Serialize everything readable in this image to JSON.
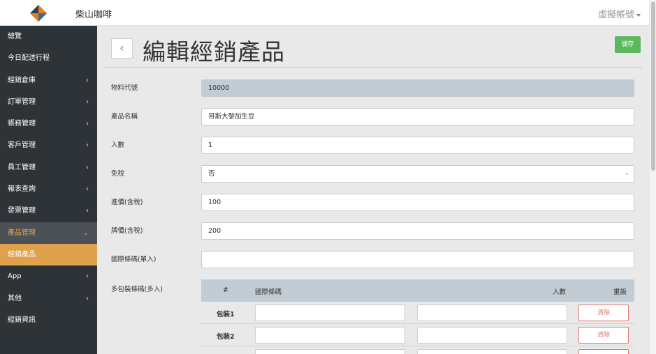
{
  "topbar": {
    "brand": "柴山咖啡",
    "user": "虛擬帳號"
  },
  "colors": {
    "sidebar_bg": "#2e3338",
    "active_item": "#e0a14c",
    "save_green": "#5cb85c",
    "clear_red": "#e4776f",
    "readonly_bg": "#c2ccd4"
  },
  "sidebar": {
    "items": [
      {
        "label": "總覽",
        "arrow": ""
      },
      {
        "label": "今日配送行程",
        "arrow": ""
      },
      {
        "label": "經銷倉庫",
        "arrow": "‹"
      },
      {
        "label": "訂單管理",
        "arrow": "‹"
      },
      {
        "label": "帳務管理",
        "arrow": "‹"
      },
      {
        "label": "客戶管理",
        "arrow": "‹"
      },
      {
        "label": "員工管理",
        "arrow": "‹"
      },
      {
        "label": "報表查詢",
        "arrow": "‹"
      },
      {
        "label": "發票管理",
        "arrow": "‹"
      },
      {
        "label": "產品管理",
        "arrow": "⌄"
      },
      {
        "label": "經銷產品",
        "arrow": ""
      },
      {
        "label": "App",
        "arrow": "‹"
      },
      {
        "label": "其他",
        "arrow": "‹"
      },
      {
        "label": "經銷資訊",
        "arrow": ""
      }
    ]
  },
  "page": {
    "title": "編輯經銷產品",
    "back": "‹",
    "save": "儲存"
  },
  "form": {
    "material_code": {
      "label": "物料代號",
      "value": "10000"
    },
    "product_name": {
      "label": "產品名稱",
      "value": "哥斯大黎加生豆"
    },
    "quantity": {
      "label": "入數",
      "value": "1"
    },
    "tax_free": {
      "label": "免稅",
      "value": "否"
    },
    "purchase_price": {
      "label": "進價(含稅)",
      "value": "100"
    },
    "list_price": {
      "label": "牌價(含稅)",
      "value": "200"
    },
    "barcode_single": {
      "label": "國際條碼(單入)",
      "value": ""
    }
  },
  "packages": {
    "label": "多包裝條碼(多入)",
    "headers": {
      "num": "#",
      "barcode": "國際條碼",
      "qty": "入數",
      "reset": "重設"
    },
    "rows": [
      {
        "name": "包裝1",
        "clear": "清除"
      },
      {
        "name": "包裝2",
        "clear": "清除"
      },
      {
        "name": "",
        "clear": ""
      }
    ]
  }
}
